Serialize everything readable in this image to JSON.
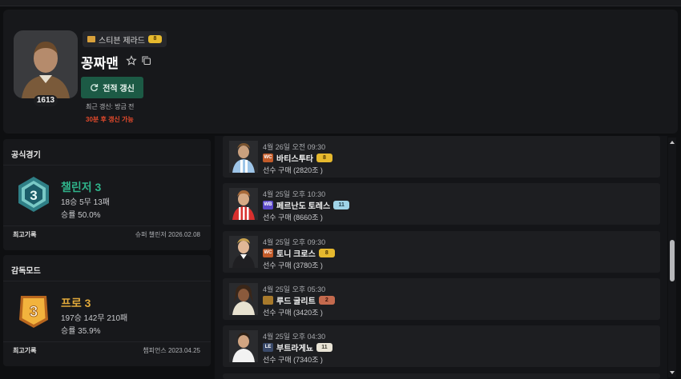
{
  "profile": {
    "level": "1613",
    "player_chip": {
      "name": "스티븐 제라드",
      "grade": "8"
    },
    "nickname": "꽁짜맨",
    "refresh_label": "전적 갱신",
    "last_update": "최근 갱신: 방금 전",
    "next_update": "30분 후 갱신 가능",
    "accent_color": "#1c5a45"
  },
  "official": {
    "title": "공식경기",
    "rank_name": "챌린저 3",
    "rank_color": "#2fb38a",
    "record": "18승 5무 13패",
    "win_rate": "승률 50.0%",
    "best_label": "최고기록",
    "best_value": "슈퍼 챌린저   2026.02.08"
  },
  "manager": {
    "title": "감독모드",
    "rank_name": "프로 3",
    "rank_color": "#e0a83a",
    "record": "197승 142무 210패",
    "win_rate": "승률 35.9%",
    "best_label": "최고기록",
    "best_value": "챔피언스   2023.04.25"
  },
  "trades": [
    {
      "date": "4월 26일 오전 09:30",
      "season": "WC",
      "season_color": "#c25b2a",
      "name": "바티스투타",
      "grade": "8",
      "grade_bg": "#e6b92e",
      "grade_fg": "#4a3200",
      "price": "선수 구매 (2820조 )",
      "photo": "player-photo-1"
    },
    {
      "date": "4월 25일 오후 10:30",
      "season": "WB",
      "season_color": "#5b49c9",
      "name": "페르난도 토레스",
      "grade": "11",
      "grade_bg": "#9fd4e8",
      "grade_fg": "#22404d",
      "price": "선수 구매 (8660조 )",
      "photo": "player-photo-2"
    },
    {
      "date": "4월 25일 오후 09:30",
      "season": "WC",
      "season_color": "#c25b2a",
      "name": "토니 크로스",
      "grade": "8",
      "grade_bg": "#e6b92e",
      "grade_fg": "#4a3200",
      "price": "선수 구매 (3780조 )",
      "photo": "player-photo-3"
    },
    {
      "date": "4월 25일 오후 05:30",
      "season": "",
      "season_color": "#a87a2c",
      "name": "루드 굴리트",
      "grade": "2",
      "grade_bg": "#c46a4e",
      "grade_fg": "#3a140a",
      "price": "선수 구매 (3420조 )",
      "photo": "player-photo-4"
    },
    {
      "date": "4월 25일 오후 04:30",
      "season": "LE",
      "season_color": "#3a4a6a",
      "name": "부트라게뇨",
      "grade": "11",
      "grade_bg": "#e9e4d6",
      "grade_fg": "#3d3a2f",
      "price": "선수 구매 (7340조 )",
      "photo": "player-photo-5"
    }
  ]
}
